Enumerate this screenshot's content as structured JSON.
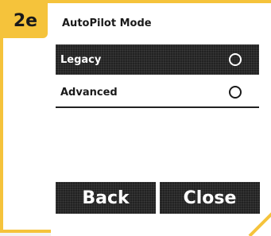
{
  "step": {
    "label": "2e"
  },
  "screen": {
    "title": "AutoPilot Mode"
  },
  "options": [
    {
      "label": "Legacy",
      "selected": true
    },
    {
      "label": "Advanced",
      "selected": false
    }
  ],
  "buttons": {
    "back": "Back",
    "close": "Close"
  },
  "colors": {
    "frame": "#f5c33b",
    "dark": "#222222",
    "text": "#1a1a1a",
    "background": "#ffffff"
  }
}
